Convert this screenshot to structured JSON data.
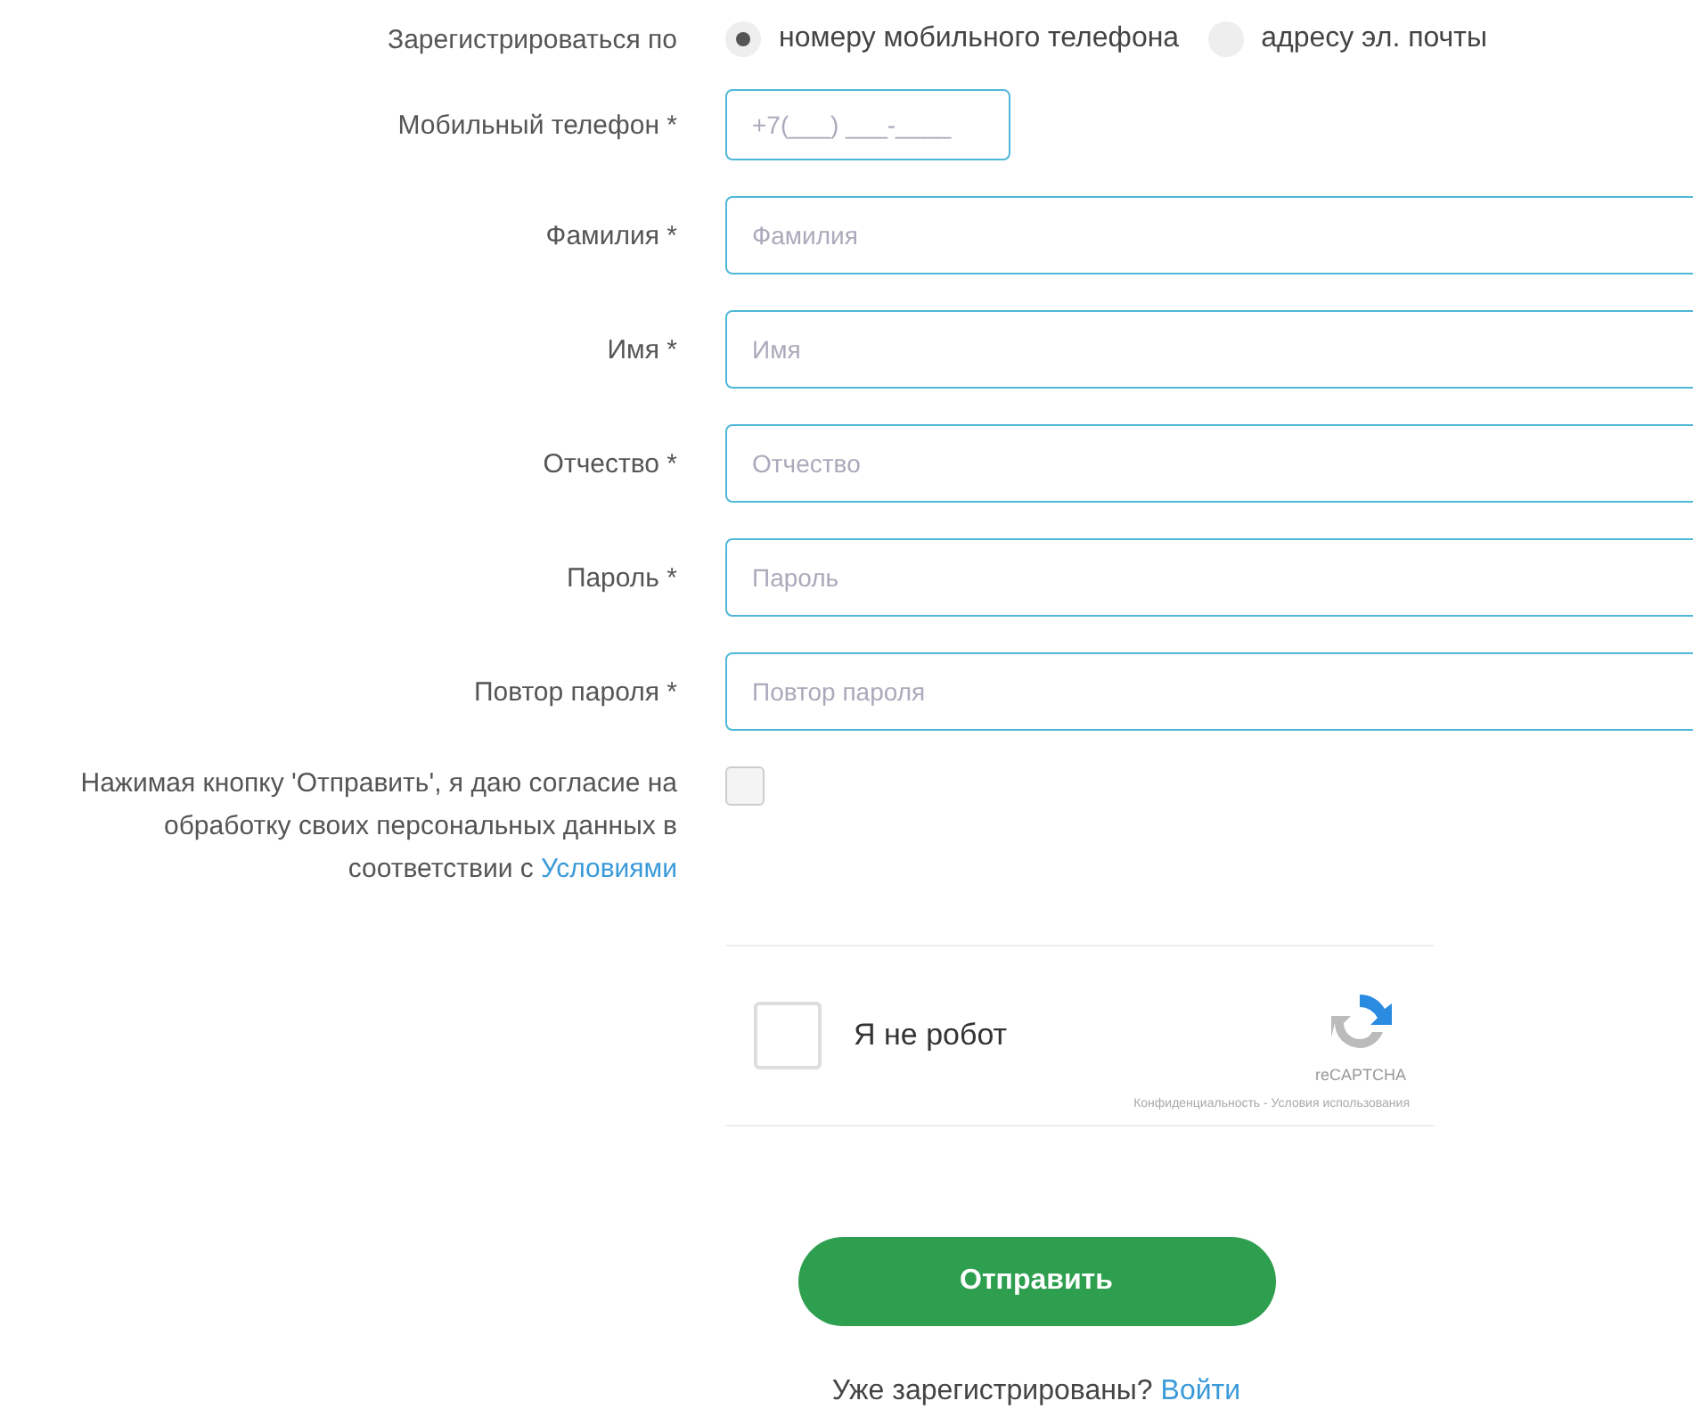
{
  "register_by": {
    "label": "Зарегистрироваться по",
    "options": [
      {
        "label": "номеру мобильного телефона",
        "selected": true
      },
      {
        "label": "адресу эл. почты",
        "selected": false
      }
    ]
  },
  "fields": [
    {
      "kind": "phone",
      "label": "Мобильный телефон *",
      "placeholder": "+7(___) ___-____"
    },
    {
      "kind": "text",
      "label": "Фамилия *",
      "placeholder": "Фамилия"
    },
    {
      "kind": "text",
      "label": "Имя *",
      "placeholder": "Имя"
    },
    {
      "kind": "text",
      "label": "Отчество *",
      "placeholder": "Отчество"
    },
    {
      "kind": "text",
      "label": "Пароль *",
      "placeholder": "Пароль"
    },
    {
      "kind": "text",
      "label": "Повтор пароля *",
      "placeholder": "Повтор пароля"
    }
  ],
  "consent": {
    "text": "Нажимая кнопку 'Отправить', я даю согласие на обработку своих персональных данных в соответствии с",
    "link": "Условиями",
    "checked": false
  },
  "captcha": {
    "label": "Я не робот",
    "checked": false,
    "brand": "reCAPTCHA",
    "footer": "Конфиденциальность - Условия использования"
  },
  "submit": "Отправить",
  "login": {
    "text": "Уже зарегистрированы?",
    "link": "Войти"
  }
}
